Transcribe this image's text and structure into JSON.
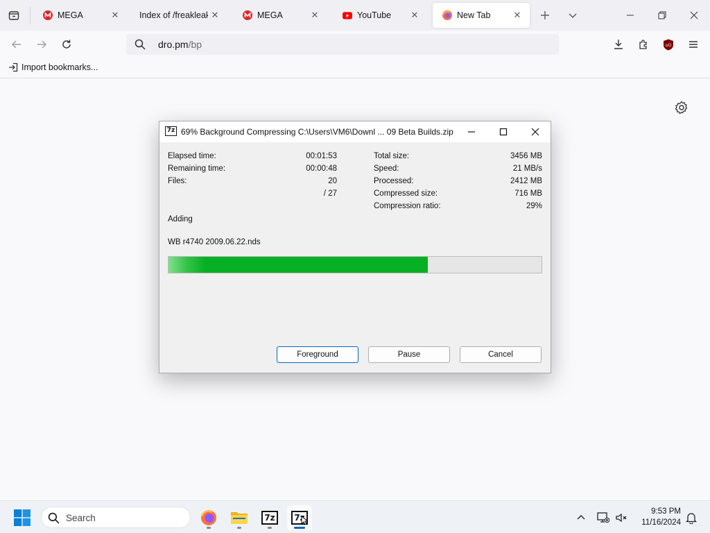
{
  "browser": {
    "tabs": [
      {
        "label": "MEGA",
        "favicon": "mega-icon",
        "active": false
      },
      {
        "label": "Index of /freakleak/Al",
        "favicon": "none",
        "active": false
      },
      {
        "label": "MEGA",
        "favicon": "mega-icon",
        "active": false
      },
      {
        "label": "YouTube",
        "favicon": "youtube-icon",
        "active": false
      },
      {
        "label": "New Tab",
        "favicon": "firefox-icon",
        "active": true
      }
    ],
    "url_host": "dro.pm",
    "url_path": "/bp",
    "bookmarks": {
      "import_label": "Import bookmarks..."
    },
    "colors": {
      "mega_red": "#d9272e",
      "youtube_red": "#ff0000",
      "ublock_red": "#800000"
    }
  },
  "dialog": {
    "title": "69% Background Compressing C:\\Users\\VM6\\Downl ... 09 Beta Builds.zip",
    "app_icon_text": "7z",
    "left_stats": [
      {
        "label": "Elapsed time:",
        "value": "00:01:53"
      },
      {
        "label": "Remaining time:",
        "value": "00:00:48"
      },
      {
        "label": "Files:",
        "value": "20"
      },
      {
        "label": "",
        "value": "/ 27"
      }
    ],
    "right_stats": [
      {
        "label": "Total size:",
        "value": "3456 MB"
      },
      {
        "label": "Speed:",
        "value": "21 MB/s"
      },
      {
        "label": "Processed:",
        "value": "2412 MB"
      },
      {
        "label": "Compressed size:",
        "value": "716 MB"
      },
      {
        "label": "Compression ratio:",
        "value": "29%"
      }
    ],
    "status": "Adding",
    "current_file": "WB r4740 2009.06.22.nds",
    "progress_percent": 69.5,
    "progress_color": "#06b025",
    "buttons": {
      "foreground": "Foreground",
      "pause": "Pause",
      "cancel": "Cancel"
    }
  },
  "taskbar": {
    "search_placeholder": "Search",
    "apps": [
      "firefox-icon",
      "file-explorer-icon",
      "7zip-icon",
      "7zip-progress-icon"
    ],
    "sevenzip_text": "7z",
    "time": "9:53 PM",
    "date": "11/16/2024"
  }
}
